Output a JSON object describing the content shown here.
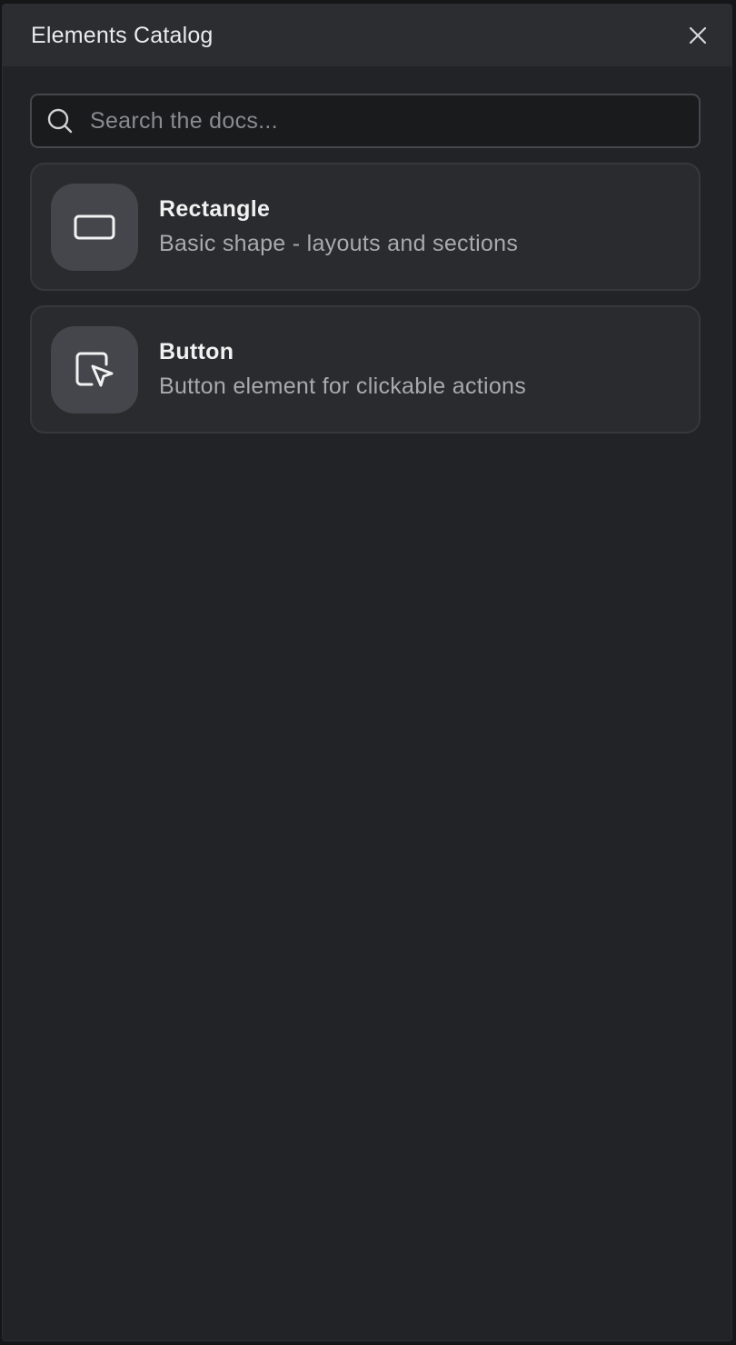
{
  "panel": {
    "title": "Elements Catalog"
  },
  "search": {
    "placeholder": "Search the docs...",
    "value": ""
  },
  "items": [
    {
      "title": "Rectangle",
      "description": "Basic shape - layouts and sections",
      "icon": "rectangle-icon"
    },
    {
      "title": "Button",
      "description": "Button element for clickable actions",
      "icon": "cursor-click-icon"
    }
  ],
  "colors": {
    "background": "#222326",
    "header": "#2c2d31",
    "card": "#2a2b2e",
    "icon_tile": "#44464b"
  }
}
